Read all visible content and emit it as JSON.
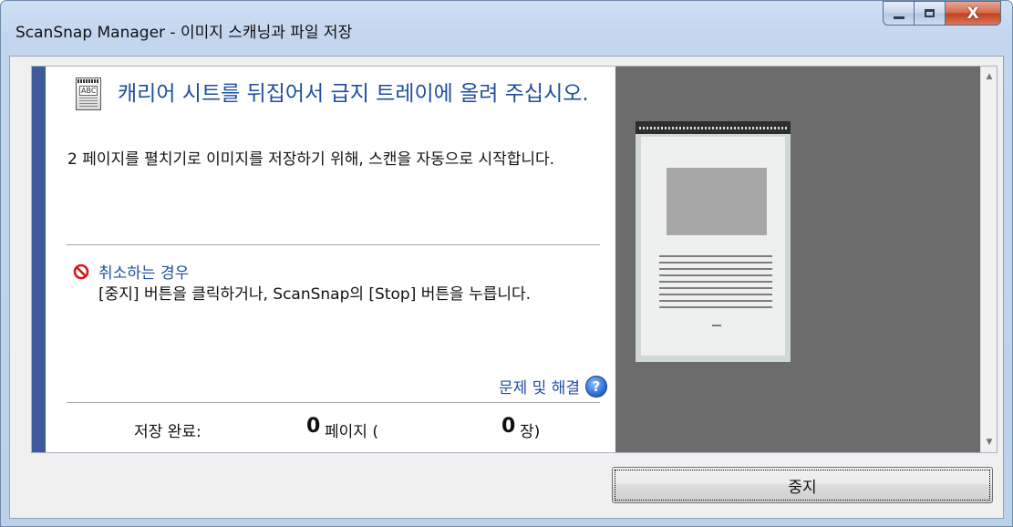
{
  "window": {
    "title": "ScanSnap Manager - 이미지 스캐닝과 파일 저장",
    "controls": {
      "minimize": "minimize-icon",
      "maximize": "maximize-icon",
      "close": "X"
    }
  },
  "instruction": {
    "icon": "carrier-sheet-icon",
    "icon_text": "ABC",
    "headline": "캐리어 시트를 뒤집어서 급지 트레이에 올려 주십시오.",
    "description": "2 페이지를 펼치기로 이미지를 저장하기 위해, 스캔을 자동으로 시작합니다."
  },
  "cancel_info": {
    "icon": "no-entry-icon",
    "title": "취소하는 경우",
    "text": "[중지] 버튼을 클릭하거나, ScanSnap의 [Stop] 버튼을 누릅니다."
  },
  "help": {
    "label": "문제 및 해결",
    "icon": "?"
  },
  "status": {
    "saved_label": "저장 완료:",
    "pages_count": "0",
    "pages_unit": "페이지 (",
    "sheets_count": "0",
    "sheets_unit": "장)"
  },
  "buttons": {
    "stop": "중지"
  },
  "colors": {
    "accent": "#3d5a9a",
    "link": "#1f4f9e",
    "preview_bg": "#6c6c6c"
  }
}
